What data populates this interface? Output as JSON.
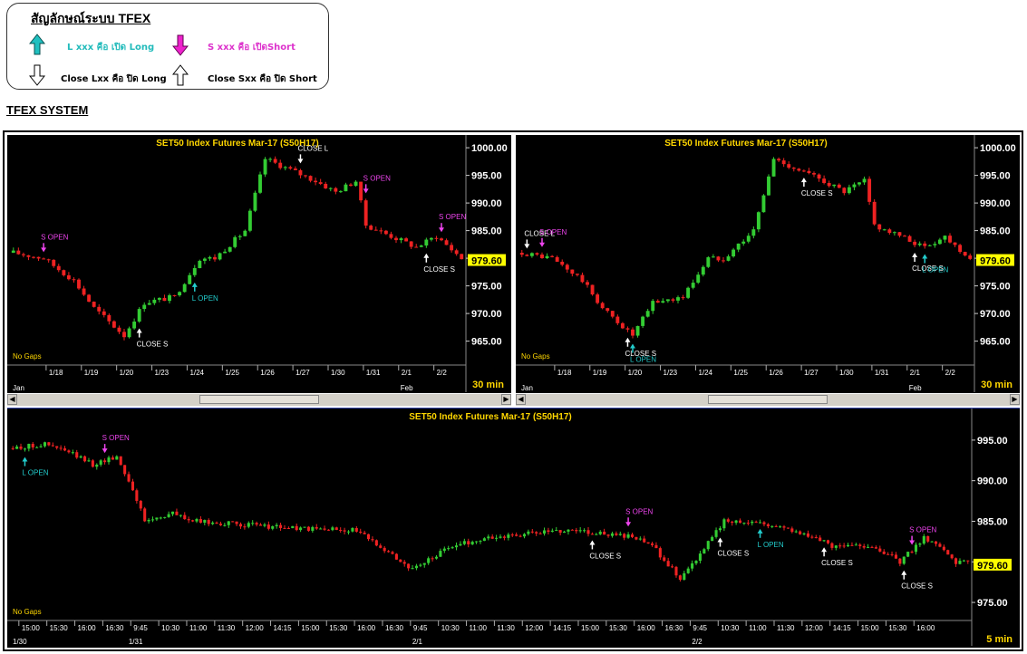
{
  "legend": {
    "title": "สัญลักษณ์ระบบ TFEX",
    "long_open": "L xxx คือ เปิด Long",
    "short_open": "S xxx คือ เปิดShort",
    "close_long": "Close Lxx คือ ปิด Long",
    "close_short": "Close Sxx คือ ปิด Short"
  },
  "system_title": "TFEX SYSTEM",
  "colors": {
    "up": "#33cc33",
    "down": "#ee2222",
    "title": "#ffd700",
    "price_tag": "#ffff00",
    "long_signal": "#22cccc",
    "short_signal": "#ee44ee",
    "close_signal": "#ffffff"
  },
  "chart_data": [
    {
      "type": "candlestick",
      "title": "SET50  Index  Futures  Mar-17  (S50H17)",
      "interval": "30  min",
      "last_price": "979.60",
      "gaps_label": "No  Gaps",
      "ylim": [
        961,
        1001
      ],
      "y_ticks": [
        "1000.00",
        "995.00",
        "990.00",
        "985.00",
        "980.00",
        "975.00",
        "970.00",
        "965.00"
      ],
      "y_tick_values": [
        1000,
        995,
        990,
        985,
        980,
        975,
        970,
        965
      ],
      "x_ticks": [
        "1/18",
        "1/19",
        "1/20",
        "1/23",
        "1/24",
        "1/25",
        "1/26",
        "1/27",
        "1/30",
        "1/31",
        "2/1",
        "2/2"
      ],
      "x_tick_bars": [
        7,
        14,
        21,
        28,
        35,
        42,
        49,
        56,
        63,
        70,
        77,
        84
      ],
      "month_labels": [
        {
          "label": "Jan",
          "bar": 0
        },
        {
          "label": "Feb",
          "bar": 77
        }
      ],
      "bar_count": 90,
      "anchors": [
        [
          0,
          981
        ],
        [
          6,
          980
        ],
        [
          12,
          976
        ],
        [
          16,
          971
        ],
        [
          22,
          966
        ],
        [
          26,
          972
        ],
        [
          32,
          973
        ],
        [
          37,
          980
        ],
        [
          40,
          980
        ],
        [
          46,
          985
        ],
        [
          50,
          998
        ],
        [
          55,
          996
        ],
        [
          60,
          994
        ],
        [
          64,
          992
        ],
        [
          68,
          994
        ],
        [
          70,
          986
        ],
        [
          75,
          984
        ],
        [
          80,
          982
        ],
        [
          84,
          984
        ],
        [
          89,
          980
        ]
      ],
      "signals": [
        {
          "label": "S  OPEN",
          "kind": "short",
          "bar": 6
        },
        {
          "label": "CLOSE  S",
          "kind": "close_short",
          "bar": 25
        },
        {
          "label": "L  OPEN",
          "kind": "long",
          "bar": 36
        },
        {
          "label": "CLOSE  L",
          "kind": "close_long",
          "bar": 57
        },
        {
          "label": "S  OPEN",
          "kind": "short",
          "bar": 70
        },
        {
          "label": "CLOSE  S",
          "kind": "close_short",
          "bar": 82
        },
        {
          "label": "S  OPEN",
          "kind": "short",
          "bar": 85
        }
      ]
    },
    {
      "type": "candlestick",
      "title": "SET50  Index  Futures  Mar-17  (S50H17)",
      "interval": "30  min",
      "last_price": "979.60",
      "gaps_label": "No  Gaps",
      "ylim": [
        961,
        1001
      ],
      "y_ticks": [
        "1000.00",
        "995.00",
        "990.00",
        "985.00",
        "980.00",
        "975.00",
        "970.00",
        "965.00"
      ],
      "y_tick_values": [
        1000,
        995,
        990,
        985,
        980,
        975,
        970,
        965
      ],
      "x_ticks": [
        "1/18",
        "1/19",
        "1/20",
        "1/23",
        "1/24",
        "1/25",
        "1/26",
        "1/27",
        "1/30",
        "1/31",
        "2/1",
        "2/2"
      ],
      "x_tick_bars": [
        7,
        14,
        21,
        28,
        35,
        42,
        49,
        56,
        63,
        70,
        77,
        84
      ],
      "month_labels": [
        {
          "label": "Jan",
          "bar": 0
        },
        {
          "label": "Feb",
          "bar": 77
        }
      ],
      "bar_count": 90,
      "anchors": [
        [
          0,
          981
        ],
        [
          6,
          980
        ],
        [
          12,
          976
        ],
        [
          16,
          971
        ],
        [
          22,
          966
        ],
        [
          26,
          972
        ],
        [
          32,
          973
        ],
        [
          37,
          980
        ],
        [
          40,
          980
        ],
        [
          46,
          985
        ],
        [
          50,
          998
        ],
        [
          55,
          996
        ],
        [
          60,
          994
        ],
        [
          64,
          992
        ],
        [
          68,
          994
        ],
        [
          70,
          986
        ],
        [
          75,
          984
        ],
        [
          80,
          982
        ],
        [
          84,
          984
        ],
        [
          89,
          980
        ]
      ],
      "signals": [
        {
          "label": "CLOSE  L",
          "kind": "close_long",
          "bar": 1
        },
        {
          "label": "S  OPEN",
          "kind": "short",
          "bar": 4
        },
        {
          "label": "CLOSE  S",
          "kind": "close_short",
          "bar": 21
        },
        {
          "label": "L  OPEN",
          "kind": "long",
          "bar": 22
        },
        {
          "label": "CLOSE  S",
          "kind": "close_short",
          "bar": 56
        },
        {
          "label": "CLOSE  S",
          "kind": "close_short",
          "bar": 78
        },
        {
          "label": "L  OPEN",
          "kind": "long",
          "bar": 80
        }
      ]
    },
    {
      "type": "candlestick",
      "title": "SET50  Index  Futures  Mar-17  (S50H17)",
      "interval": "5  min",
      "last_price": "979.60",
      "gaps_label": "No  Gaps",
      "ylim": [
        973,
        998
      ],
      "y_ticks": [
        "995.00",
        "990.00",
        "985.00",
        "980.00",
        "975.00"
      ],
      "y_tick_values": [
        995,
        990,
        985,
        980,
        975
      ],
      "x_ticks": [
        "15:00",
        "15:30",
        "16:00",
        "16:30",
        "9:45",
        "10:30",
        "11:00",
        "11:30",
        "12:00",
        "14:15",
        "15:00",
        "15:30",
        "16:00",
        "16:30",
        "9:45",
        "10:30",
        "11:00",
        "11:30",
        "12:00",
        "14:15",
        "15:00",
        "15:30",
        "16:00",
        "16:30",
        "9:45",
        "10:30",
        "11:00",
        "11:30",
        "12:00",
        "14:15",
        "15:00",
        "15:30",
        "16:00"
      ],
      "x_tick_bars": [
        2,
        9,
        16,
        23,
        30,
        37,
        44,
        51,
        58,
        65,
        72,
        79,
        86,
        93,
        100,
        107,
        114,
        121,
        128,
        135,
        142,
        149,
        156,
        163,
        170,
        177,
        184,
        191,
        198,
        205,
        212,
        219,
        226
      ],
      "month_labels": [
        {
          "label": "1/30",
          "bar": 0
        },
        {
          "label": "1/31",
          "bar": 29
        },
        {
          "label": "2/1",
          "bar": 100
        },
        {
          "label": "2/2",
          "bar": 170
        }
      ],
      "bar_count": 240,
      "anchors": [
        [
          0,
          994
        ],
        [
          8,
          994.5
        ],
        [
          14,
          993.5
        ],
        [
          20,
          992
        ],
        [
          26,
          993
        ],
        [
          30,
          989
        ],
        [
          33,
          985
        ],
        [
          40,
          986
        ],
        [
          45,
          985
        ],
        [
          60,
          984.5
        ],
        [
          75,
          984
        ],
        [
          85,
          984
        ],
        [
          92,
          982
        ],
        [
          100,
          979
        ],
        [
          110,
          982
        ],
        [
          120,
          983
        ],
        [
          140,
          984
        ],
        [
          155,
          983
        ],
        [
          160,
          982
        ],
        [
          167,
          978
        ],
        [
          172,
          981
        ],
        [
          178,
          985
        ],
        [
          185,
          985
        ],
        [
          195,
          984
        ],
        [
          205,
          982
        ],
        [
          215,
          982
        ],
        [
          222,
          980
        ],
        [
          228,
          983
        ],
        [
          232,
          982
        ],
        [
          236,
          980
        ],
        [
          239,
          980
        ]
      ],
      "signals": [
        {
          "label": "L  OPEN",
          "kind": "long",
          "bar": 3
        },
        {
          "label": "S  OPEN",
          "kind": "short",
          "bar": 23
        },
        {
          "label": "CLOSE  S",
          "kind": "close_short",
          "bar": 145
        },
        {
          "label": "S  OPEN",
          "kind": "short",
          "bar": 154
        },
        {
          "label": "CLOSE  S",
          "kind": "close_short",
          "bar": 177
        },
        {
          "label": "L  OPEN",
          "kind": "long",
          "bar": 187
        },
        {
          "label": "CLOSE  S",
          "kind": "close_short",
          "bar": 203
        },
        {
          "label": "CLOSE  S",
          "kind": "close_short",
          "bar": 223
        },
        {
          "label": "S  OPEN",
          "kind": "short",
          "bar": 225
        }
      ]
    }
  ]
}
